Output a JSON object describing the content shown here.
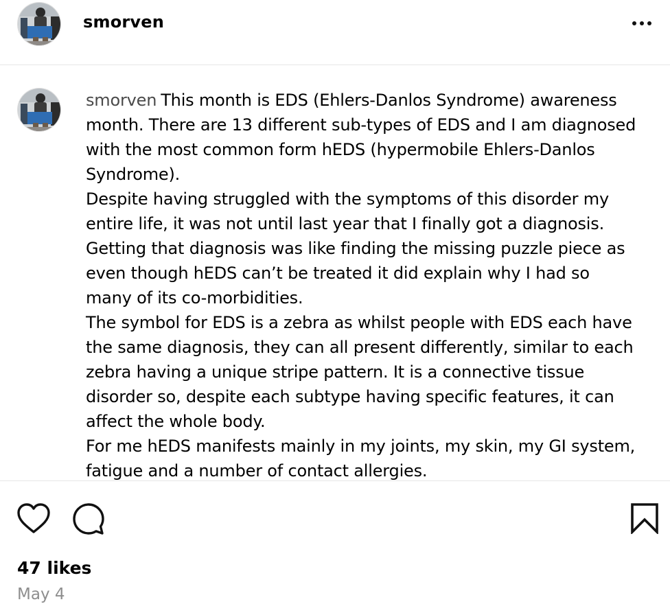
{
  "post": {
    "username": "smorven",
    "more_icon": "more-horizontal-icon",
    "caption_username": "smorven",
    "caption_text": "This month is EDS (Ehlers-Danlos Syndrome) awareness month. There are 13 different sub-types of EDS and I am diagnosed with the most common form hEDS (hypermobile Ehlers-Danlos Syndrome).\nDespite having struggled with the symptoms of this disorder my entire life, it was not until last year that I finally got a diagnosis. Getting that diagnosis was like finding the missing puzzle piece as even though hEDS can’t be treated it did explain why I had so many of its co-morbidities.\nThe symbol for EDS is a zebra as whilst people with EDS each have the same diagnosis, they can all present differently, similar to each zebra having a unique stripe pattern. It is a connective tissue disorder so, despite each subtype having specific features, it can affect the whole body.\nFor me hEDS manifests mainly in my joints, my skin, my GI system, fatigue and a number of contact allergies.",
    "likes": "47 likes",
    "date": "May 4"
  },
  "icons": {
    "like": "heart-outline-icon",
    "comment": "comment-bubble-icon",
    "save": "bookmark-outline-icon"
  }
}
